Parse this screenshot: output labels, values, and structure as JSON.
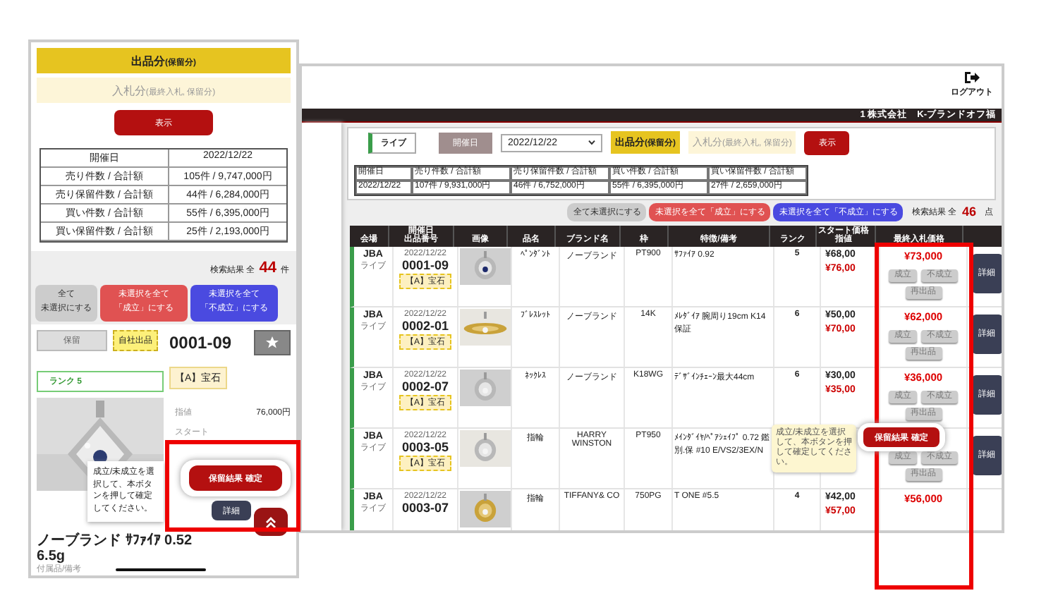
{
  "phone": {
    "mode_buttons": [
      {
        "label": "出品分",
        "note": "(保留分)",
        "selected": true
      },
      {
        "label": "入札分",
        "note": "(最終入札, 保留分)",
        "selected": false
      }
    ],
    "show_button": "表示",
    "summary": [
      {
        "label": "開催日",
        "value": "2022/12/22"
      },
      {
        "label": "売り件数 / 合計額",
        "value": "105件 / 9,747,000円"
      },
      {
        "label": "売り保留件数 / 合計額",
        "value": "44件 / 6,284,000円"
      },
      {
        "label": "買い件数 / 合計額",
        "value": "55件 / 6,395,000円"
      },
      {
        "label": "買い保留件数 / 合計額",
        "value": "25件 / 2,193,000円"
      }
    ],
    "result": {
      "label": "検索結果 全",
      "count": "44",
      "unit": "件"
    },
    "bulk_buttons": [
      {
        "lines": [
          "全て",
          "未選択にする"
        ],
        "kind": "clear"
      },
      {
        "lines": [
          "未選択を全て",
          "「成立」にする"
        ],
        "kind": "accept"
      },
      {
        "lines": [
          "未選択を全て",
          "「不成立」にする"
        ],
        "kind": "reject"
      }
    ],
    "item": {
      "status": "保留",
      "source": "自社出品",
      "number": "0001-09",
      "rank": "ランク 5",
      "category": "【A】宝石",
      "prices": [
        {
          "label": "指値",
          "value": "76,000円"
        },
        {
          "label": "スタート"
        }
      ],
      "tooltip": "成立/未成立を選択して、本ボタンを押して確定してください。",
      "confirm_button": "保留結果 確定",
      "detail_button": "詳細",
      "title": "ノーブランド ｻﾌｧｲｱ 0.52",
      "weight": "6.5g",
      "note": "付属品/備考"
    }
  },
  "desktop": {
    "logout": "ログアウト",
    "company": "1 株式会社　K-ブランドオフ福",
    "live_tag": "ライブ",
    "date_label": "開催日",
    "date_value": "2022/12/22",
    "mode_buttons": [
      {
        "label": "出品分",
        "note": "(保留分)",
        "selected": true
      },
      {
        "label": "入札分",
        "note": "(最終入札, 保留分)",
        "selected": false
      }
    ],
    "show_button": "表示",
    "summary": {
      "columns": [
        "開催日",
        "売り件数 / 合計額",
        "売り保留件数 / 合計額",
        "買い件数 / 合計額",
        "買い保留件数 / 合計額"
      ],
      "values": [
        "2022/12/22",
        "107件 / 9,931,000円",
        "46件 / 6,752,000円",
        "55件 / 6,395,000円",
        "27件 / 2,659,000円"
      ]
    },
    "bulk_buttons": [
      {
        "label": "全て未選択にする",
        "kind": "clear"
      },
      {
        "label": "未選択を全て「成立」にする",
        "kind": "accept"
      },
      {
        "label": "未選択を全て「不成立」にする",
        "kind": "reject"
      }
    ],
    "result": {
      "label": "検索結果 全",
      "count": "46",
      "unit": "点"
    },
    "table": {
      "columns": [
        [
          "会場"
        ],
        [
          "開催日",
          "出品番号"
        ],
        [
          "画像"
        ],
        [
          "品名"
        ],
        [
          "ブランド名"
        ],
        [
          "枠"
        ],
        [
          "特徴/備考"
        ],
        [
          "ランク"
        ],
        [
          "スタート価格",
          "指値"
        ],
        [
          "最終入札価格"
        ]
      ],
      "rows": [
        {
          "venue": "JBA",
          "venue_type": "ライブ",
          "date": "2022/12/22",
          "number": "0001-09",
          "category": "【A】宝石",
          "item": "ﾍﾟﾝﾀﾞﾝﾄ",
          "brand": "ノーブランド",
          "material": "PT900",
          "notes": "ｻﾌｧｲｱ 0.92",
          "rank": "5",
          "start_price": "¥68,00",
          "limit_price": "¥76,00",
          "last_bid": "¥73,000",
          "actions": [
            "成立",
            "不成立",
            "再出品"
          ],
          "detail_button": "詳細"
        },
        {
          "venue": "JBA",
          "venue_type": "ライブ",
          "date": "2022/12/22",
          "number": "0002-01",
          "category": "【A】宝石",
          "item": "ﾌﾞﾚｽﾚｯﾄ",
          "brand": "ノーブランド",
          "material": "14K",
          "notes": "ﾒﾚﾀﾞｲｱ 腕周り19cm K14保証",
          "rank": "6",
          "start_price": "¥50,00",
          "limit_price": "¥70,00",
          "last_bid": "¥62,000",
          "actions": [
            "成立",
            "不成立",
            "再出品"
          ],
          "detail_button": "詳細"
        },
        {
          "venue": "JBA",
          "venue_type": "ライブ",
          "date": "2022/12/22",
          "number": "0002-07",
          "category": "【A】宝石",
          "item": "ﾈｯｸﾚｽ",
          "brand": "ノーブランド",
          "material": "K18WG",
          "notes": "ﾃﾞｻﾞｲﾝﾁｪｰﾝ最大44cm",
          "rank": "6",
          "start_price": "¥30,00",
          "limit_price": "¥35,00",
          "last_bid": "¥36,000",
          "actions": [
            "成立",
            "不成立",
            "再出品"
          ],
          "detail_button": "詳細"
        },
        {
          "venue": "JBA",
          "venue_type": "ライブ",
          "date": "2022/12/22",
          "number": "0003-05",
          "category": "【A】宝石",
          "item": "指輪",
          "brand": "HARRY WINSTON",
          "material": "PT950",
          "notes": "ﾒｲﾝﾀﾞｲﾔ/ﾍﾟｱｼｪｲﾌﾟ 0.72 鑑別.保 #10 E/VS2/3EX/N",
          "actions": [
            "成立",
            "不成立",
            "再出品"
          ],
          "detail_button": "詳細"
        },
        {
          "venue": "JBA",
          "venue_type": "ライブ",
          "date": "2022/12/22",
          "number": "0003-07",
          "item": "指輪",
          "brand": "TIFFANY& CO",
          "material": "750PG",
          "notes": "T ONE #5.5",
          "rank": "4",
          "start_price": "¥42,00",
          "limit_price": "¥57,00",
          "last_bid": "¥56,000"
        }
      ]
    },
    "tooltip": "成立/未成立を選択して、本ボタンを押して確定してください。",
    "confirm_button": "保留結果 確定"
  }
}
